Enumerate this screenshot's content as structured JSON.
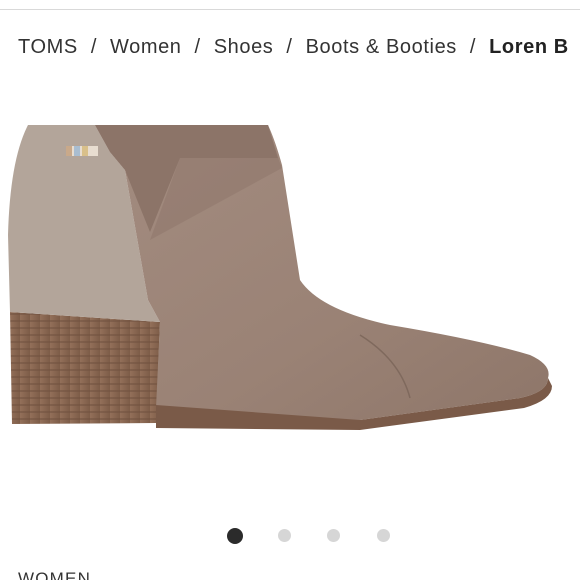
{
  "breadcrumb": {
    "items": [
      {
        "label": "TOMS"
      },
      {
        "label": "Women"
      },
      {
        "label": "Shoes"
      },
      {
        "label": "Boots & Booties"
      }
    ],
    "separator": "/",
    "current": "Loren B"
  },
  "product_image": {
    "description_icon": "ankle-bootie-image",
    "colors": {
      "suede": "#9c8478",
      "felt_panel": "#b3a59a",
      "heel_wood": "#8a6650",
      "sole": "#7a5a48"
    }
  },
  "carousel": {
    "dot_count": 4,
    "active_index": 0
  },
  "section": {
    "label": "WOMEN"
  }
}
